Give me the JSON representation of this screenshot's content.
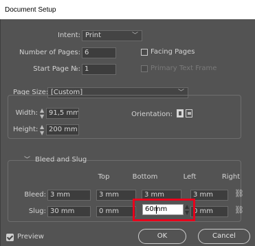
{
  "window": {
    "title": "Document Setup"
  },
  "intent": {
    "label": "Intent:",
    "value": "Print"
  },
  "pages": {
    "number_label": "Number of Pages:",
    "number_value": "6",
    "start_label": "Start Page №:",
    "start_value": "1",
    "facing_label": "Facing Pages",
    "facing_checked": false,
    "primary_label": "Primary Text Frame",
    "primary_checked": false
  },
  "page_size": {
    "label": "Page Size:",
    "value": "[Custom]",
    "width_label": "Width:",
    "width_value": "91,5 mm",
    "height_label": "Height:",
    "height_value": "200 mm",
    "orientation_label": "Orientation:"
  },
  "bleed_slug": {
    "header": "Bleed and Slug",
    "columns": [
      "Top",
      "Bottom",
      "Left",
      "Right"
    ],
    "bleed_label": "Bleed:",
    "bleed": [
      "3 mm",
      "3 mm",
      "3 mm",
      "3 mm"
    ],
    "slug_label": "Slug:",
    "slug": [
      "30 mm",
      "0 mm",
      "60mm",
      "0 mm"
    ]
  },
  "footer": {
    "preview_label": "Preview",
    "preview_checked": true,
    "ok_label": "OK",
    "cancel_label": "Cancel"
  },
  "colors": {
    "highlight": "#e8001c",
    "dialog_bg": "#535353"
  }
}
